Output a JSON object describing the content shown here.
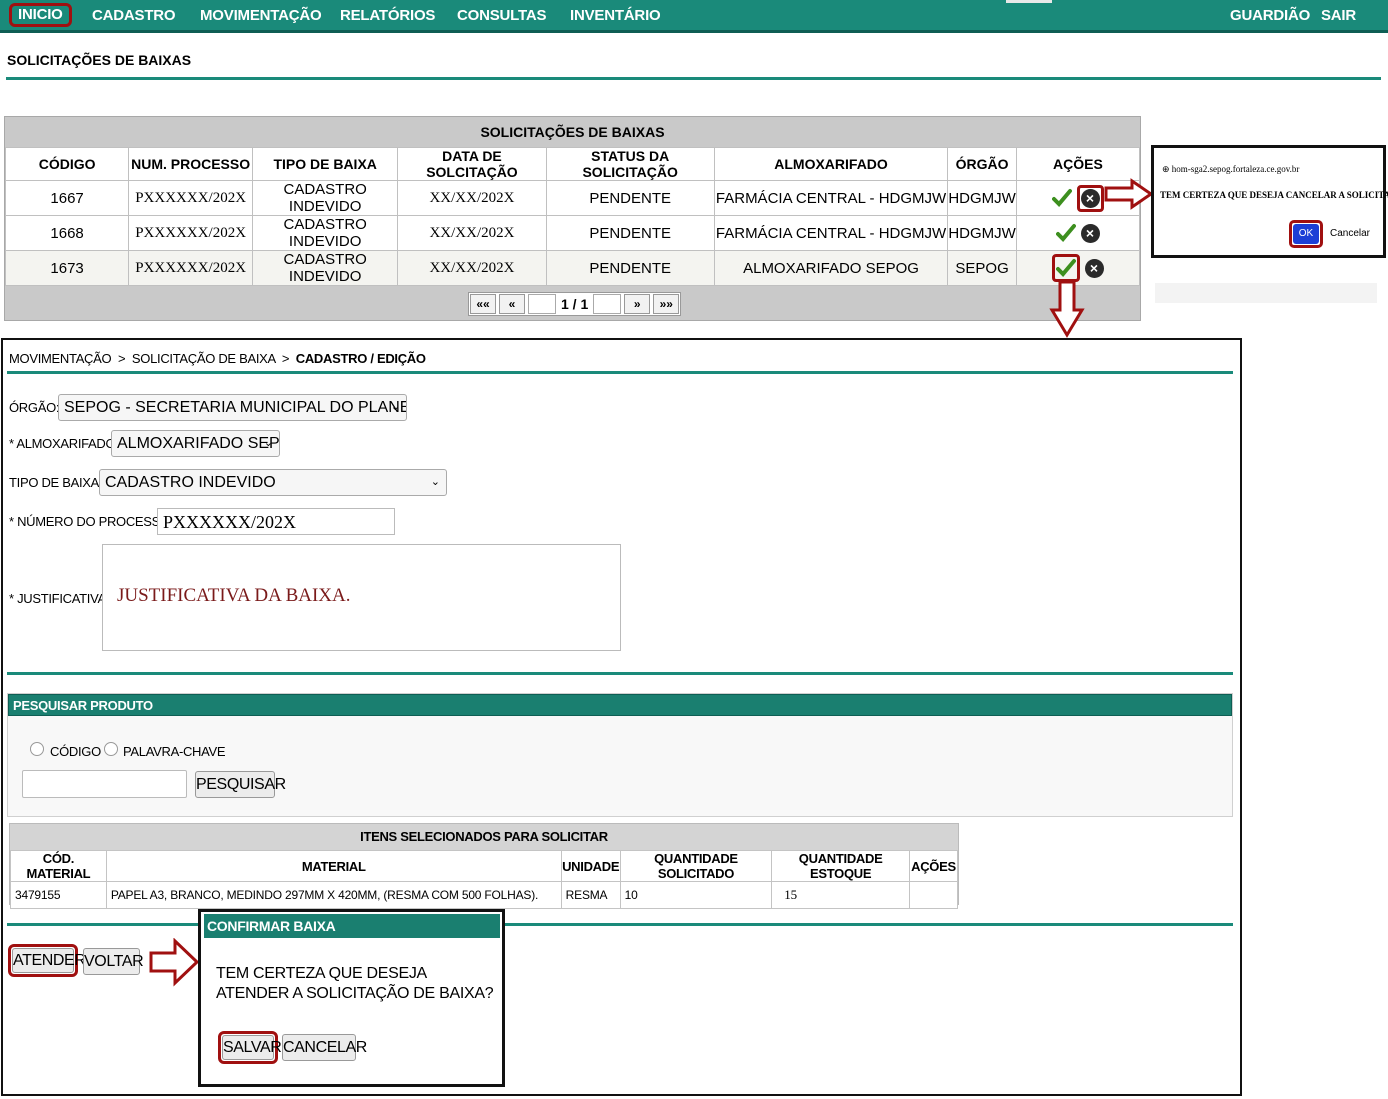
{
  "nav": {
    "items": [
      "INICIO",
      "CADASTRO",
      "MOVIMENTAÇÃO",
      "RELATÓRIOS",
      "CONSULTAS",
      "INVENTÁRIO"
    ],
    "right": [
      "GUARDIÃO",
      "SAIR"
    ]
  },
  "page_title": "SOLICITAÇÕES DE BAIXAS",
  "list": {
    "caption": "SOLICITAÇÕES DE BAIXAS",
    "columns": [
      "CÓDIGO",
      "NUM. PROCESSO",
      "TIPO DE BAIXA",
      "DATA DE SOLCITAÇÃO",
      "STATUS DA SOLICITAÇÃO",
      "ALMOXARIFADO",
      "ÓRGÃO",
      "AÇÕES"
    ],
    "rows": [
      {
        "codigo": "1667",
        "processo": "PXXXXXX/202X",
        "tipo": "CADASTRO INDEVIDO",
        "data": "XX/XX/202X",
        "status": "PENDENTE",
        "almox": "FARMÁCIA CENTRAL - HDGMJW",
        "orgao": "HDGMJW"
      },
      {
        "codigo": "1668",
        "processo": "PXXXXXX/202X",
        "tipo": "CADASTRO INDEVIDO",
        "data": "XX/XX/202X",
        "status": "PENDENTE",
        "almox": "FARMÁCIA CENTRAL - HDGMJW",
        "orgao": "HDGMJW"
      },
      {
        "codigo": "1673",
        "processo": "PXXXXXX/202X",
        "tipo": "CADASTRO INDEVIDO",
        "data": "XX/XX/202X",
        "status": "PENDENTE",
        "almox": "ALMOXARIFADO SEPOG",
        "orgao": "SEPOG"
      }
    ],
    "pager": {
      "first": "««",
      "prev": "«",
      "page_text": "1 / 1",
      "next": "»",
      "last": "»»"
    }
  },
  "browser_confirm": {
    "host": "hom-sga2.sepog.fortaleza.ce.gov.br",
    "message": "TEM CERTEZA QUE DESEJA CANCELAR A SOLICITAÇÃO?",
    "ok": "OK",
    "cancel": "Cancelar"
  },
  "form": {
    "breadcrumb": {
      "a": "MOVIMENTAÇÃO",
      "b": "SOLICITAÇÃO DE BAIXA",
      "c": "CADASTRO / EDIÇÃO",
      "sep": ">"
    },
    "orgao_label": "ÓRGÃO:",
    "orgao_value": "SEPOG - SECRETARIA MUNICIPAL DO PLANEJAMENTO,",
    "almox_label": "* ALMOXARIFADO:",
    "almox_value": "ALMOXARIFADO SEPOG",
    "tipo_label": "TIPO DE BAIXA:",
    "tipo_value": "CADASTRO INDEVIDO",
    "processo_label": "* NÚMERO DO PROCESSO:",
    "processo_value": "PXXXXXX/202X",
    "just_label": "* JUSTIFICATIVA:",
    "just_value": "JUSTIFICATIVA DA BAIXA."
  },
  "search": {
    "header": "PESQUISAR PRODUTO",
    "opt_codigo": "CÓDIGO",
    "opt_palavra": "PALAVRA-CHAVE",
    "button": "PESQUISAR"
  },
  "items": {
    "caption": "ITENS SELECIONADOS PARA SOLICITAR",
    "columns": [
      "CÓD. MATERIAL",
      "MATERIAL",
      "UNIDADE",
      "QUANTIDADE SOLICITADO",
      "QUANTIDADE ESTOQUE",
      "AÇÕES"
    ],
    "rows": [
      {
        "cod": "3479155",
        "material": "PAPEL A3, BRANCO, MEDINDO 297MM X 420MM, (RESMA COM 500 FOLHAS).",
        "unidade": "RESMA",
        "qtd_sol": "10",
        "qtd_est": "15",
        "acoes": ""
      }
    ]
  },
  "actions": {
    "atender": "ATENDER",
    "voltar": "VOLTAR"
  },
  "modal": {
    "header": "CONFIRMAR BAIXA",
    "message": "TEM CERTEZA QUE DESEJA ATENDER A SOLICITAÇÃO DE BAIXA?",
    "save": "SALVAR",
    "cancel": "CANCELAR"
  },
  "colors": {
    "nav": "#1a8a7a",
    "highlight": "#a01010",
    "ok_button": "#1c3fd6"
  },
  "icons": [
    "check-icon",
    "cancel-icon",
    "arrow-right-icon",
    "arrow-down-icon",
    "chevron-down-icon",
    "globe-icon"
  ]
}
